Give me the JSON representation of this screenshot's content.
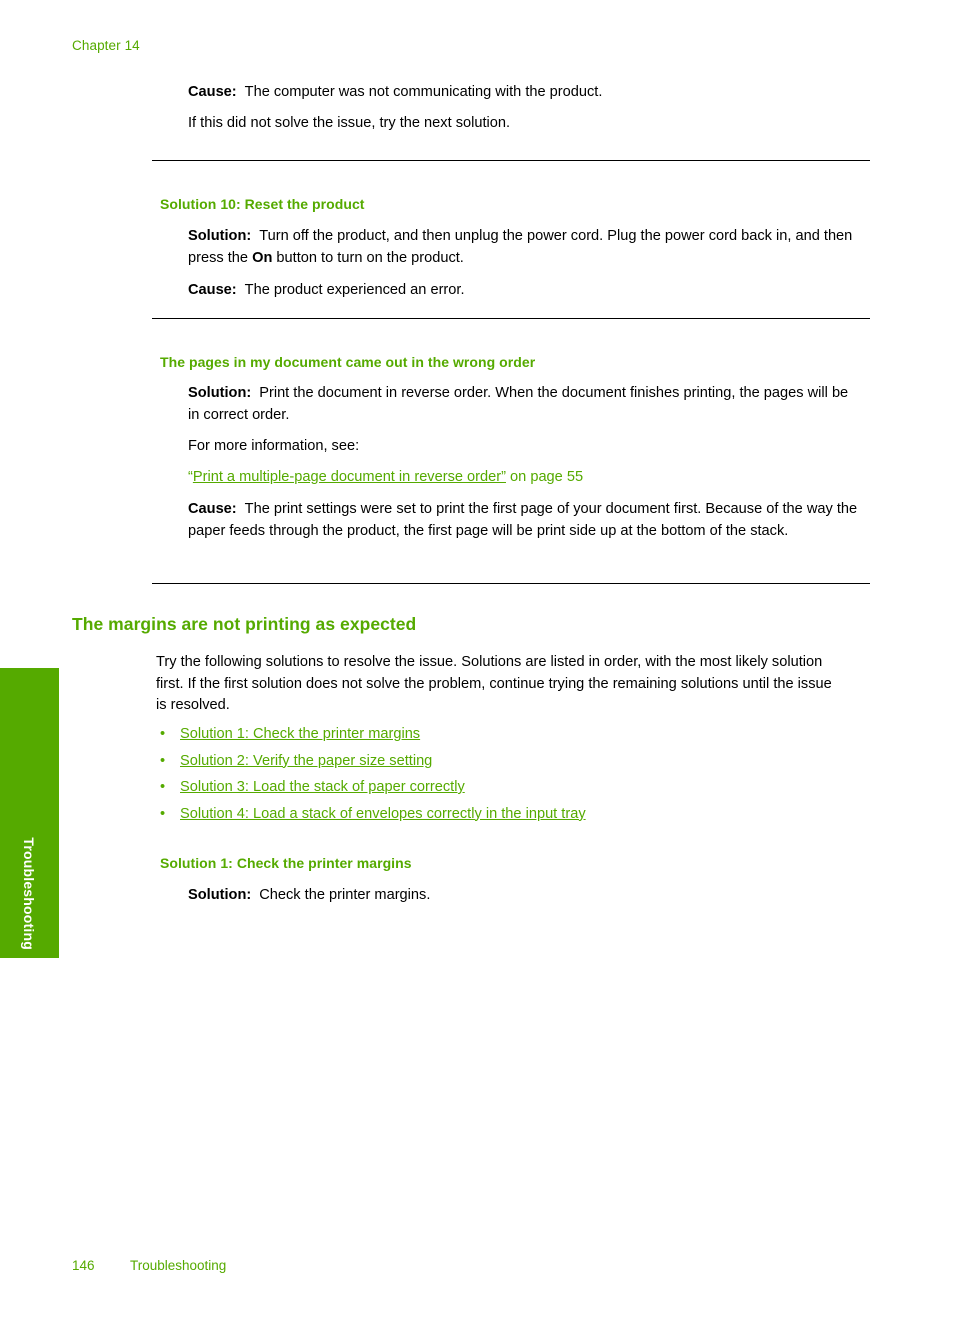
{
  "page": {
    "chapter_header": "Chapter 14",
    "side_tab_label": "Troubleshooting",
    "footer": {
      "page_number": "146",
      "section_name": "Troubleshooting"
    },
    "accent_color": "#55aa00",
    "text_color": "#000000",
    "background_color": "#ffffff"
  },
  "blocks": {
    "cause_prev": {
      "label": "Cause:",
      "text": "The computer was not communicating with the product.",
      "followup": "If this did not solve the issue, try the next solution."
    },
    "solution10": {
      "heading": "Solution 10: Reset the product",
      "solution_label": "Solution:",
      "solution_text_part1": "Turn off the product, and then unplug the power cord. Plug the power cord back in, and then press the ",
      "solution_bold_term": "On",
      "solution_text_part2": " button to turn on the product.",
      "cause_label": "Cause:",
      "cause_text": "The product experienced an error."
    },
    "wrong_order": {
      "heading": "The pages in my document came out in the wrong order",
      "solution_label": "Solution:",
      "solution_text": "Print the document in reverse order. When the document finishes printing, the pages will be in correct order.",
      "more_info": "For more information, see:",
      "xref_open_quote": "“",
      "xref_link_text": "Print a multiple-page document in reverse order”",
      "xref_suffix": " on page 55",
      "cause_label": "Cause:",
      "cause_text": "The print settings were set to print the first page of your document first. Because of the way the paper feeds through the product, the first page will be print side up at the bottom of the stack."
    },
    "margins": {
      "heading": "The margins are not printing as expected",
      "intro": "Try the following solutions to resolve the issue. Solutions are listed in order, with the most likely solution first. If the first solution does not solve the problem, continue trying the remaining solutions until the issue is resolved.",
      "bullet_glyph": "•",
      "solutions": [
        {
          "label": "Solution 1: Check the printer margins"
        },
        {
          "label": "Solution 2: Verify the paper size setting"
        },
        {
          "label": "Solution 3: Load the stack of paper correctly"
        },
        {
          "label": "Solution 4: Load a stack of envelopes correctly in the input tray"
        }
      ]
    },
    "solution1": {
      "heading": "Solution 1: Check the printer margins",
      "solution_label": "Solution:",
      "solution_text": "Check the printer margins."
    }
  }
}
